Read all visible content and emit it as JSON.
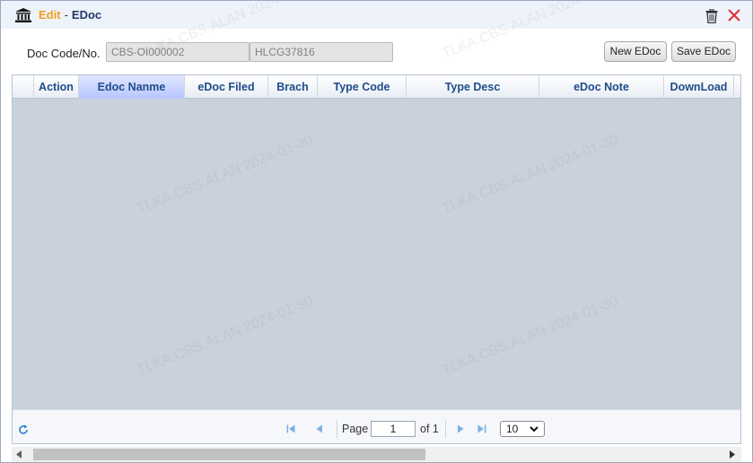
{
  "window": {
    "mode": "Edit",
    "separator": "-",
    "title": "EDoc"
  },
  "form": {
    "doc_label": "Doc Code/No.",
    "doc_code": "CBS-OI000002",
    "doc_no": "HLCG37816",
    "new_button": "New EDoc",
    "save_button": "Save EDoc"
  },
  "grid": {
    "columns": [
      "Action",
      "Edoc Nanme",
      "eDoc Filed",
      "Brach",
      "Type Code",
      "Type Desc",
      "eDoc Note",
      "DownLoad"
    ],
    "rows": []
  },
  "pager": {
    "page_label": "Page",
    "page_value": "1",
    "of_label": "of 1",
    "page_size": "10"
  },
  "watermark": "TLKA.CBS.ALAN 2024-01-30",
  "colors": {
    "mode_accent": "#f0a020",
    "title": "#1f3a66",
    "column_header_text": "#1f4c8a",
    "active_column": "#b8c6ff",
    "grid_body": "#c8d1dc",
    "close_red": "#e03030"
  },
  "icons": {
    "title": "bank-icon",
    "delete": "trash-icon",
    "close": "close-icon",
    "refresh": "refresh-icon",
    "first": "first-page-icon",
    "prev": "prev-page-icon",
    "next": "next-page-icon",
    "last": "last-page-icon"
  }
}
